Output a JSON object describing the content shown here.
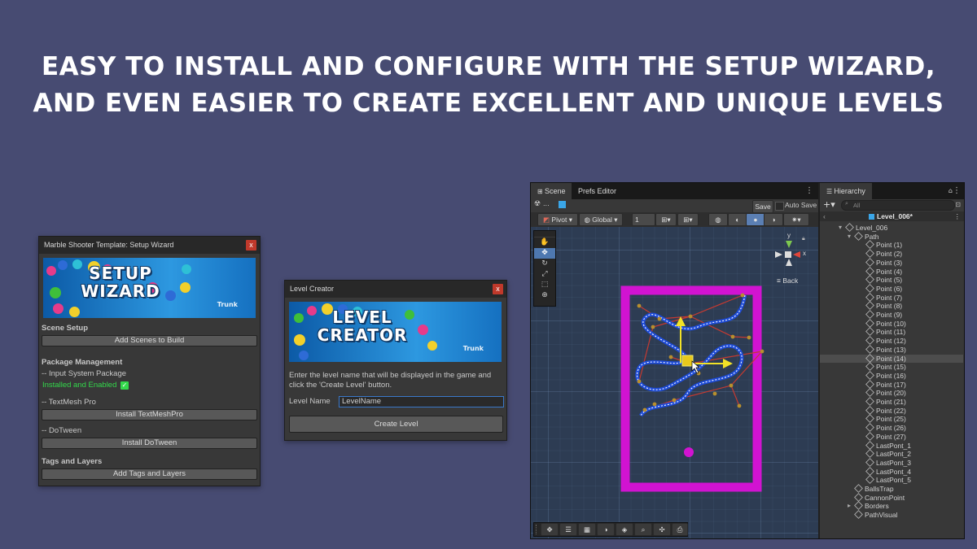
{
  "headline": {
    "line1": "EASY TO INSTALL AND CONFIGURE WITH THE SETUP WIZARD,",
    "line2": "AND EVEN EASIER TO CREATE EXCELLENT AND UNIQUE LEVELS"
  },
  "setup_wizard": {
    "title": "Marble Shooter Template: Setup Wizard",
    "close": "x",
    "banner_line1": "SETUP",
    "banner_line2": "WIZARD",
    "logo": "Trunk",
    "scene_setup": "Scene Setup",
    "add_scenes_button": "Add Scenes to Build",
    "package_management": "Package Management",
    "input_system": "-- Input System Package",
    "input_status": "Installed and Enabled",
    "textmesh": "-- TextMesh Pro",
    "install_textmesh_button": "Install TextMeshPro",
    "dotween": "-- DoTween",
    "install_dotween_button": "Install DoTween",
    "tags_layers": "Tags and Layers",
    "add_tags_button": "Add Tags and Layers"
  },
  "level_creator": {
    "title": "Level Creator",
    "close": "x",
    "banner_line1": "LEVEL",
    "banner_line2": "CREATOR",
    "logo": "Trunk",
    "description": "Enter the level name that will be displayed in the game and click the 'Create Level' button.",
    "level_name_label": "Level Name",
    "level_name_value": "LevelName",
    "create_button": "Create Level"
  },
  "scene_view": {
    "tabs": [
      "Scene",
      "Prefs Editor"
    ],
    "save_label": "Save",
    "autosave_label": "Auto Save",
    "pivot_label": "Pivot",
    "global_label": "Global",
    "grid_value": "1",
    "back_label": "≡ Back",
    "axis_y": "y",
    "axis_x": "x",
    "dots_label": "..."
  },
  "hierarchy": {
    "tab": "Hierarchy",
    "search_placeholder": "All",
    "scene_name": "Level_006*",
    "items": [
      {
        "label": "Level_006",
        "indent": 0,
        "selected": false
      },
      {
        "label": "Path",
        "indent": 1,
        "selected": false
      },
      {
        "label": "Point (1)",
        "indent": 2,
        "selected": false
      },
      {
        "label": "Point (2)",
        "indent": 2,
        "selected": false
      },
      {
        "label": "Point (3)",
        "indent": 2,
        "selected": false
      },
      {
        "label": "Point (4)",
        "indent": 2,
        "selected": false
      },
      {
        "label": "Point (5)",
        "indent": 2,
        "selected": false
      },
      {
        "label": "Point (6)",
        "indent": 2,
        "selected": false
      },
      {
        "label": "Point (7)",
        "indent": 2,
        "selected": false
      },
      {
        "label": "Point (8)",
        "indent": 2,
        "selected": false
      },
      {
        "label": "Point (9)",
        "indent": 2,
        "selected": false
      },
      {
        "label": "Point (10)",
        "indent": 2,
        "selected": false
      },
      {
        "label": "Point (11)",
        "indent": 2,
        "selected": false
      },
      {
        "label": "Point (12)",
        "indent": 2,
        "selected": false
      },
      {
        "label": "Point (13)",
        "indent": 2,
        "selected": false
      },
      {
        "label": "Point (14)",
        "indent": 2,
        "selected": true
      },
      {
        "label": "Point (15)",
        "indent": 2,
        "selected": false
      },
      {
        "label": "Point (16)",
        "indent": 2,
        "selected": false
      },
      {
        "label": "Point (17)",
        "indent": 2,
        "selected": false
      },
      {
        "label": "Point (20)",
        "indent": 2,
        "selected": false
      },
      {
        "label": "Point (21)",
        "indent": 2,
        "selected": false
      },
      {
        "label": "Point (22)",
        "indent": 2,
        "selected": false
      },
      {
        "label": "Point (25)",
        "indent": 2,
        "selected": false
      },
      {
        "label": "Point (26)",
        "indent": 2,
        "selected": false
      },
      {
        "label": "Point (27)",
        "indent": 2,
        "selected": false
      },
      {
        "label": "LastPont_1",
        "indent": 2,
        "selected": false
      },
      {
        "label": "LastPont_2",
        "indent": 2,
        "selected": false
      },
      {
        "label": "LastPont_3",
        "indent": 2,
        "selected": false
      },
      {
        "label": "LastPont_4",
        "indent": 2,
        "selected": false
      },
      {
        "label": "LastPont_5",
        "indent": 2,
        "selected": false
      },
      {
        "label": "BallsTrap",
        "indent": 1,
        "selected": false
      },
      {
        "label": "CannonPoint",
        "indent": 1,
        "selected": false
      },
      {
        "label": "Borders",
        "indent": 1,
        "selected": false
      },
      {
        "label": "PathVisual",
        "indent": 1,
        "selected": false
      }
    ]
  },
  "colors": {
    "background": "#474b72",
    "border_magenta": "#d113d1",
    "path_blue": "#1d4bd8",
    "gizmo_yellow": "#f2e227",
    "installed_green": "#33d94b"
  }
}
